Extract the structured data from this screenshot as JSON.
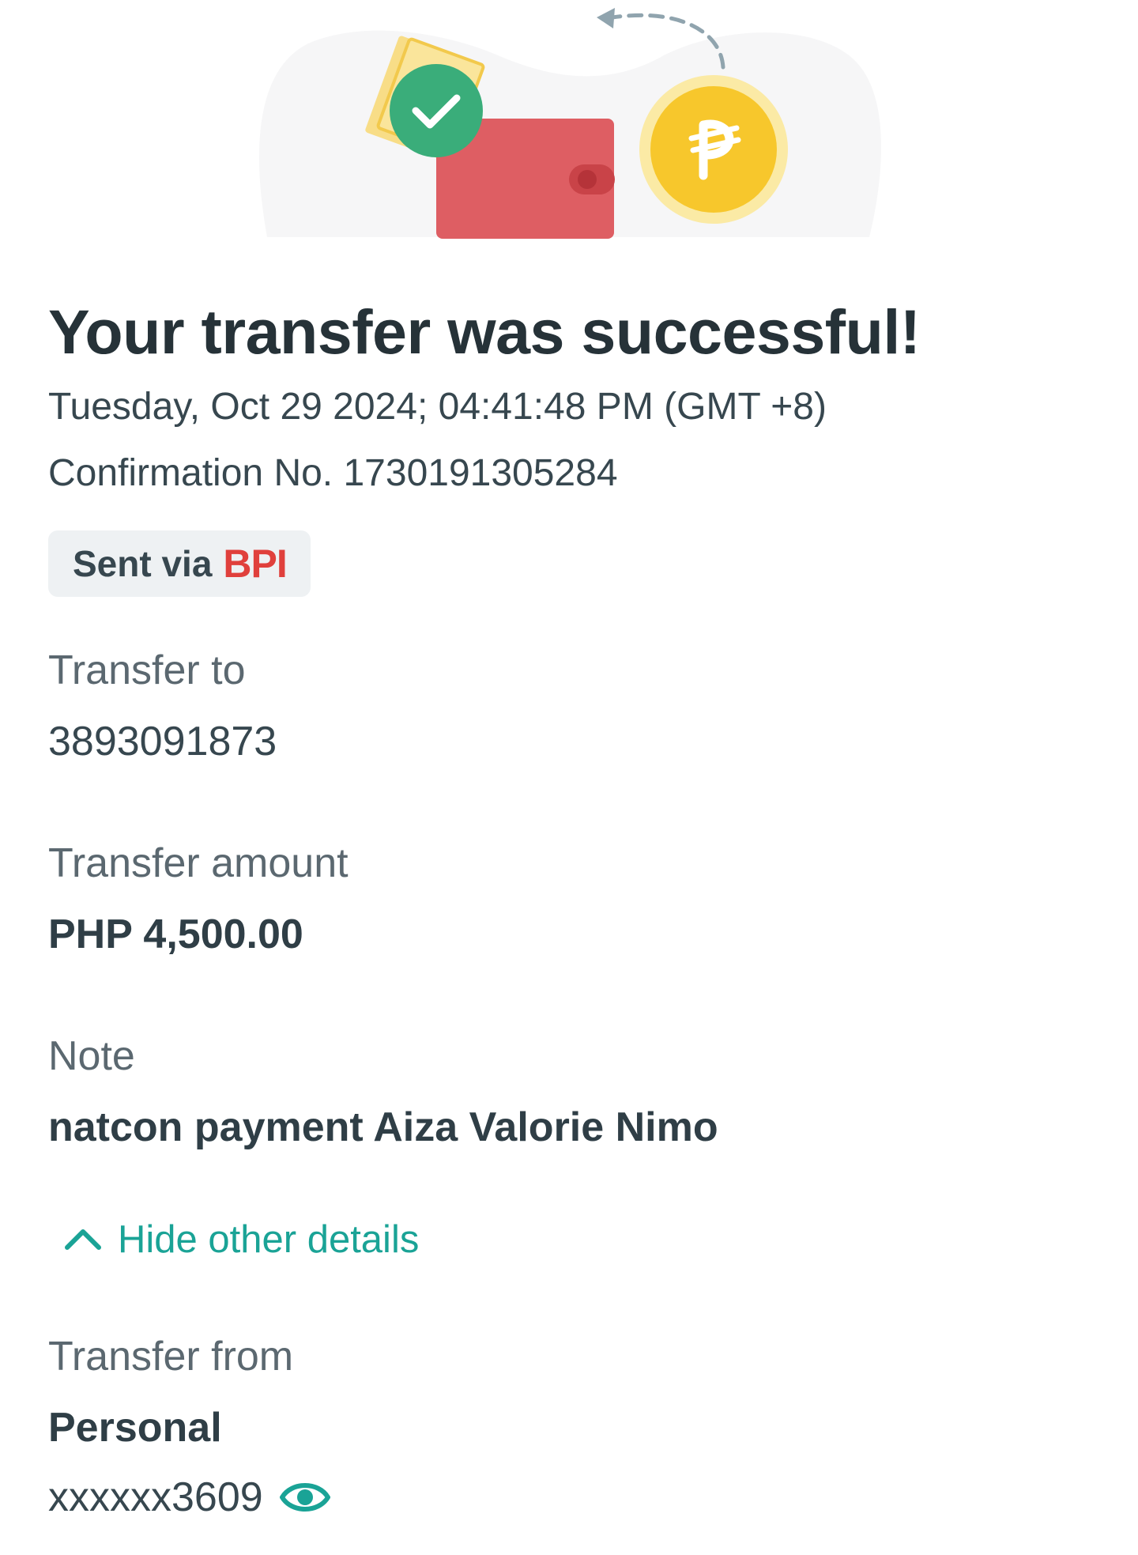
{
  "header": {
    "title": "Your transfer was successful!",
    "datetime": "Tuesday, Oct 29 2024; 04:41:48 PM (GMT +8)",
    "confirmation": "Confirmation No. 1730191305284"
  },
  "sent_via": {
    "prefix": "Sent via",
    "bank": "BPI"
  },
  "transfer_to": {
    "label": "Transfer to",
    "value": "3893091873"
  },
  "transfer_amount": {
    "label": "Transfer amount",
    "value": "PHP 4,500.00"
  },
  "note": {
    "label": "Note",
    "value": "natcon payment Aiza Valorie Nimo"
  },
  "toggle": {
    "label": "Hide other details",
    "icon": "chevron-up-icon"
  },
  "transfer_from": {
    "label": "Transfer from",
    "account_type": "Personal",
    "account_number": "xxxxxx3609",
    "reveal_icon": "eye-icon"
  },
  "colors": {
    "accent": "#1aa396",
    "bank_brand": "#e0403c",
    "success": "#3aad7a",
    "coin": "#f7c72c",
    "wallet": "#de5e63"
  }
}
